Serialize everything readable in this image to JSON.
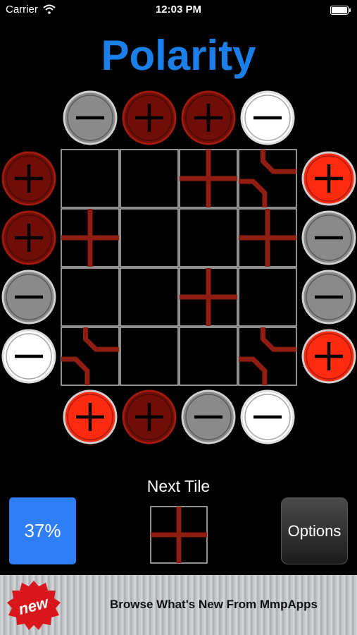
{
  "status_bar": {
    "carrier": "Carrier",
    "time": "12:03 PM"
  },
  "title": "Polarity",
  "board": {
    "rows": 4,
    "cols": 4,
    "colors": {
      "plus_dark": "#6e0e06",
      "plus_bright": "#ff2a10",
      "minus_gray": "#8a8a8a",
      "minus_white": "#ffffff",
      "wire": "#8f1d12",
      "grid": "#bdbdbd"
    },
    "top_poles": [
      {
        "sign": "-",
        "style": "gray"
      },
      {
        "sign": "+",
        "style": "dark"
      },
      {
        "sign": "+",
        "style": "dark"
      },
      {
        "sign": "-",
        "style": "white"
      }
    ],
    "bottom_poles": [
      {
        "sign": "+",
        "style": "bright"
      },
      {
        "sign": "+",
        "style": "dark"
      },
      {
        "sign": "-",
        "style": "gray"
      },
      {
        "sign": "-",
        "style": "white"
      }
    ],
    "left_poles": [
      {
        "sign": "+",
        "style": "dark"
      },
      {
        "sign": "+",
        "style": "dark"
      },
      {
        "sign": "-",
        "style": "gray"
      },
      {
        "sign": "-",
        "style": "white"
      }
    ],
    "right_poles": [
      {
        "sign": "+",
        "style": "bright"
      },
      {
        "sign": "-",
        "style": "gray"
      },
      {
        "sign": "-",
        "style": "gray"
      },
      {
        "sign": "+",
        "style": "bright"
      }
    ],
    "tiles": [
      [
        "empty",
        "empty",
        "cross",
        "curve-tr-bl"
      ],
      [
        "cross-dark",
        "empty",
        "empty",
        "cross"
      ],
      [
        "empty",
        "empty",
        "cross",
        "empty"
      ],
      [
        "curve-tr-bl",
        "empty",
        "empty",
        "curve-tr-bl"
      ]
    ]
  },
  "next_tile": {
    "label": "Next Tile",
    "tile": "cross"
  },
  "progress_button": {
    "label": "37%"
  },
  "options_button": {
    "label": "Options"
  },
  "ad_banner": {
    "badge": "new",
    "text": "Browse What's New From MmpApps"
  }
}
